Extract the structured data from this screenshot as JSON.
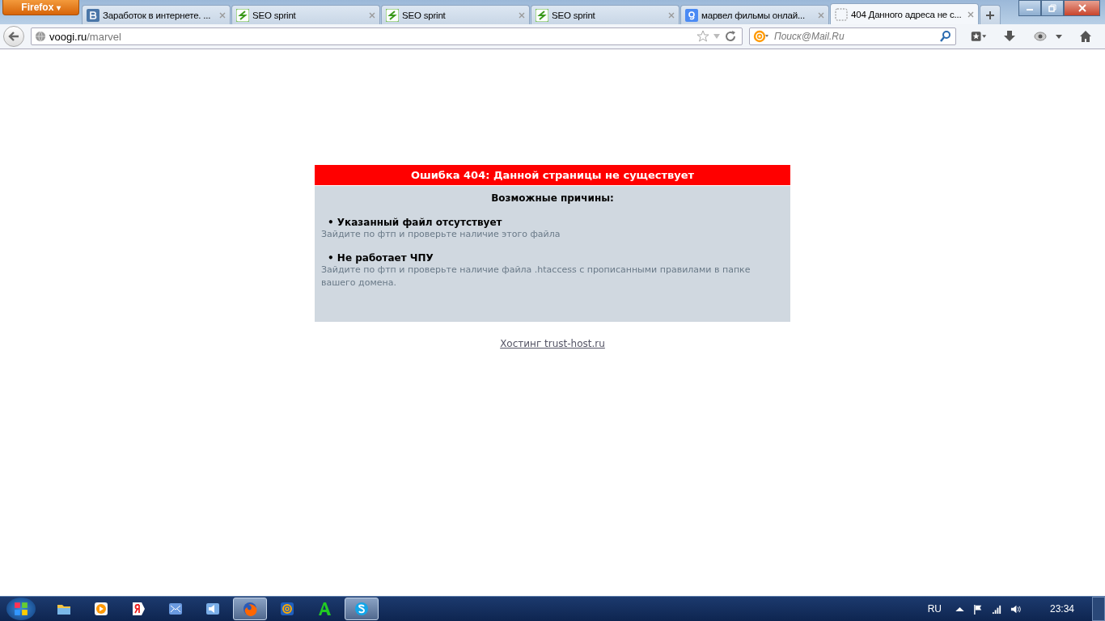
{
  "browser": {
    "menu_button": "Firefox",
    "menu_caret": "▾",
    "tabs": [
      {
        "kind": "vk",
        "title": "Заработок в интернете. ...",
        "selected": false
      },
      {
        "kind": "seo",
        "title": "SEO sprint",
        "selected": false
      },
      {
        "kind": "seo",
        "title": "SEO sprint",
        "selected": false
      },
      {
        "kind": "seo",
        "title": "SEO sprint",
        "selected": false
      },
      {
        "kind": "google",
        "title": "марвел фильмы онлай...",
        "selected": false
      },
      {
        "kind": "blank",
        "title": "404 Данного адреса не с...",
        "selected": true
      }
    ],
    "address": {
      "host": "voogi.ru",
      "path": "/marvel"
    },
    "search": {
      "placeholder": "Поиск@Mail.Ru"
    }
  },
  "page": {
    "error_title": "Ошибка 404: Данной страницы не существует",
    "causes_heading": "Возможные причины:",
    "causes": [
      {
        "title": "• Указанный файл отсутствует",
        "text": "Зайдите по фтп и проверьте наличие этого файла"
      },
      {
        "title": "• Не работает ЧПУ",
        "text": "Зайдите по фтп и проверьте наличие файла .htaccess с прописанными правилами в папке вашего домена."
      }
    ],
    "footer_link": "Хостинг trust-host.ru"
  },
  "taskbar": {
    "apps": [
      {
        "kind": "folder",
        "open": false
      },
      {
        "kind": "player",
        "open": false
      },
      {
        "kind": "yandex",
        "open": false
      },
      {
        "kind": "mail",
        "open": false
      },
      {
        "kind": "sound",
        "open": false
      },
      {
        "kind": "firefox",
        "open": true
      },
      {
        "kind": "at",
        "open": false
      },
      {
        "kind": "green-a",
        "open": false
      },
      {
        "kind": "skype",
        "open": true
      }
    ],
    "language": "RU",
    "time": "23:34"
  }
}
